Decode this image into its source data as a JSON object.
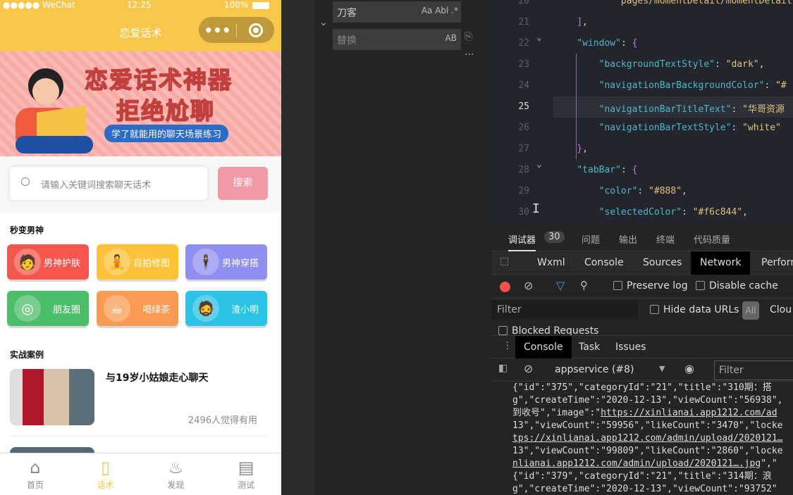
{
  "phone": {
    "status": {
      "carrier": "●●●●● WeChat",
      "time": "12:25",
      "battery": "100%"
    },
    "nav_title": "恋爱话术",
    "banner": {
      "line1": "恋爱话术神器",
      "line2": "拒绝尬聊",
      "tagline": "学了就能用的聊天场景练习"
    },
    "search": {
      "placeholder": "请输入关键词搜索聊天话术",
      "button": "搜索"
    },
    "section1": "秒变男神",
    "cards": [
      {
        "label": "男神护肤",
        "color": "#f5574f"
      },
      {
        "label": "自拍修图",
        "color": "#fbc23a"
      },
      {
        "label": "男神穿搭",
        "color": "#8e8ff0"
      },
      {
        "label": "朋友圈",
        "color": "#4cbd68"
      },
      {
        "label": "喝绿茶",
        "color": "#f99b52"
      },
      {
        "label": "渣小明",
        "color": "#2cc3e6"
      }
    ],
    "section2": "实战案例",
    "cases": [
      {
        "title": "与19岁小姑娘走心聊天",
        "meta": "2496人觉得有用"
      }
    ],
    "tabs": [
      {
        "label": "首页",
        "icon": "home-icon"
      },
      {
        "label": "话术",
        "icon": "book-icon",
        "active": true
      },
      {
        "label": "发现",
        "icon": "flame-icon"
      },
      {
        "label": "测试",
        "icon": "document-icon"
      }
    ],
    "accent": "#f6c844"
  },
  "find": {
    "search_value": "刀客",
    "replace_placeholder": "替换",
    "opts": "Aa  Abl  .*",
    "replace_opt": "AB"
  },
  "editor": {
    "lines": [
      {
        "n": "20",
        "html": "            <span class='s'>pages/momentDetail/momentDetail</span>"
      },
      {
        "n": "21",
        "html": "    <span class='p'>]</span><span class='w'>,</span>"
      },
      {
        "n": "22",
        "html": "    <span class='k'>\"window\"</span><span class='w'>: </span><span class='p'>{</span>"
      },
      {
        "n": "23",
        "html": "        <span class='k'>\"backgroundTextStyle\"</span><span class='w'>: </span><span class='s'>\"dark\"</span><span class='w'>,</span>"
      },
      {
        "n": "24",
        "html": "        <span class='k'>\"navigationBarBackgroundColor\"</span><span class='w'>: </span><span class='s'>\"#</span>"
      },
      {
        "n": "25",
        "html": "        <span class='k'>\"navigationBarTitleText\"</span><span class='w'>: </span><span class='s'>\"华哥资源</span>"
      },
      {
        "n": "26",
        "html": "        <span class='k'>\"navigationBarTextStyle\"</span><span class='w'>: </span><span class='s'>\"white\"</span>"
      },
      {
        "n": "27",
        "html": "    <span class='p'>}</span><span class='w'>,</span>"
      },
      {
        "n": "28",
        "html": "    <span class='k'>\"tabBar\"</span><span class='w'>: </span><span class='p'>{</span>"
      },
      {
        "n": "29",
        "html": "        <span class='k'>\"color\"</span><span class='w'>: </span><span class='s'>\"#888\"</span><span class='w'>,</span>"
      },
      {
        "n": "30",
        "html": "        <span class='k'>\"selectedColor\"</span><span class='w'>: </span><span class='s'>\"#f6c844\"</span><span class='w'>,</span>"
      }
    ]
  },
  "devtools": {
    "panel_tabs": [
      "调试器",
      "问题",
      "输出",
      "终端",
      "代码质量"
    ],
    "badge": "30",
    "tools": [
      "Wxml",
      "Console",
      "Sources",
      "Network",
      "Perform"
    ],
    "preserve_log": "Preserve log",
    "disable_cache": "Disable cache",
    "filter_placeholder": "Filter",
    "hide_data_urls": "Hide data URLs",
    "all": "All",
    "cloud": "Clou",
    "blocked": "Blocked Requests",
    "drawer_tabs": [
      "Console",
      "Task",
      "Issues"
    ],
    "context": "appservice (#8)",
    "console_filter": "Filter",
    "log": [
      "{\"id\":\"375\",\"categoryId\":\"21\",\"title\":\"310期：搭",
      "g\",\"createTime\":\"2020-12-13\",\"viewCount\":\"56938\",",
      "到收号\",\"image\":\"<u>https://xinlianai.app1212.com/ad</u>",
      "13\",\"viewCount\":\"59956\",\"likeCount\":\"3470\",\"locke",
      "<u>tps://xinlianai.app1212.com/admin/upload/2020121…</u>",
      "13\",\"viewCount\":\"99809\",\"likeCount\":\"2860\",\"locke",
      "<u>nlianai.app1212.com/admin/upload/2020121….jpg</u>\",\"",
      "{\"id\":\"379\",\"categoryId\":\"21\",\"title\":\"314期：浪",
      "g\",\"createTime\":\"2020-12-13\",\"viewCount\":\"93752\""
    ]
  }
}
